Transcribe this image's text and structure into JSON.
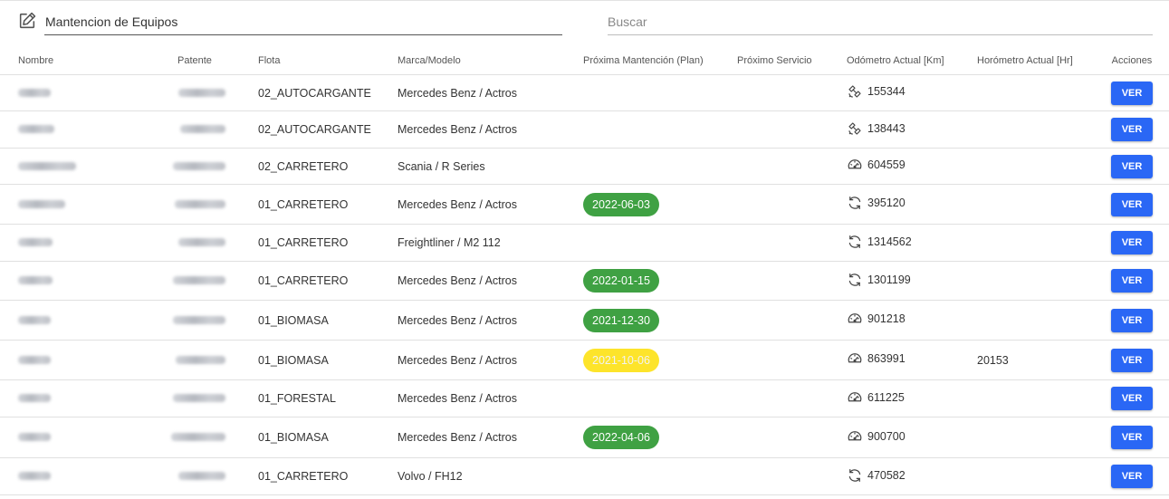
{
  "header": {
    "title": "Mantencion de Equipos",
    "search_placeholder": "Buscar"
  },
  "columns": [
    "Nombre",
    "Patente",
    "Flota",
    "Marca/Modelo",
    "Próxima Mantención (Plan)",
    "Próximo Servicio",
    "Odómetro Actual [Km]",
    "Horómetro Actual [Hr]",
    "Acciones"
  ],
  "action_label": "VER",
  "colors": {
    "badge_green": "#3fa143",
    "badge_yellow": "#fde42b",
    "button_blue": "#2a67f5"
  },
  "rows": [
    {
      "flota": "02_AUTOCARGANTE",
      "marca": "Mercedes Benz / Actros",
      "plan": "",
      "plan_color": "",
      "servicio": "",
      "odo_icon": "satellite-icon",
      "odometro": "155344",
      "horometro": ""
    },
    {
      "flota": "02_AUTOCARGANTE",
      "marca": "Mercedes Benz / Actros",
      "plan": "",
      "plan_color": "",
      "servicio": "",
      "odo_icon": "satellite-icon",
      "odometro": "138443",
      "horometro": ""
    },
    {
      "flota": "02_CARRETERO",
      "marca": "Scania / R Series",
      "plan": "",
      "plan_color": "",
      "servicio": "",
      "odo_icon": "speedometer-icon",
      "odometro": "604559",
      "horometro": ""
    },
    {
      "flota": "01_CARRETERO",
      "marca": "Mercedes Benz / Actros",
      "plan": "2022-06-03",
      "plan_color": "green",
      "servicio": "",
      "odo_icon": "sync-icon",
      "odometro": "395120",
      "horometro": ""
    },
    {
      "flota": "01_CARRETERO",
      "marca": "Freightliner / M2 112",
      "plan": "",
      "plan_color": "",
      "servicio": "",
      "odo_icon": "sync-icon",
      "odometro": "1314562",
      "horometro": ""
    },
    {
      "flota": "01_CARRETERO",
      "marca": "Mercedes Benz / Actros",
      "plan": "2022-01-15",
      "plan_color": "green",
      "servicio": "",
      "odo_icon": "sync-icon",
      "odometro": "1301199",
      "horometro": ""
    },
    {
      "flota": "01_BIOMASA",
      "marca": "Mercedes Benz / Actros",
      "plan": "2021-12-30",
      "plan_color": "green",
      "servicio": "",
      "odo_icon": "speedometer-icon",
      "odometro": "901218",
      "horometro": ""
    },
    {
      "flota": "01_BIOMASA",
      "marca": "Mercedes Benz / Actros",
      "plan": "2021-10-06",
      "plan_color": "yellow",
      "servicio": "",
      "odo_icon": "speedometer-icon",
      "odometro": "863991",
      "horometro": "20153"
    },
    {
      "flota": "01_FORESTAL",
      "marca": "Mercedes Benz / Actros",
      "plan": "",
      "plan_color": "",
      "servicio": "",
      "odo_icon": "speedometer-icon",
      "odometro": "611225",
      "horometro": ""
    },
    {
      "flota": "01_BIOMASA",
      "marca": "Mercedes Benz / Actros",
      "plan": "2022-04-06",
      "plan_color": "green",
      "servicio": "",
      "odo_icon": "speedometer-icon",
      "odometro": "900700",
      "horometro": ""
    },
    {
      "flota": "01_CARRETERO",
      "marca": "Volvo / FH12",
      "plan": "",
      "plan_color": "",
      "servicio": "",
      "odo_icon": "sync-icon",
      "odometro": "470582",
      "horometro": ""
    }
  ]
}
